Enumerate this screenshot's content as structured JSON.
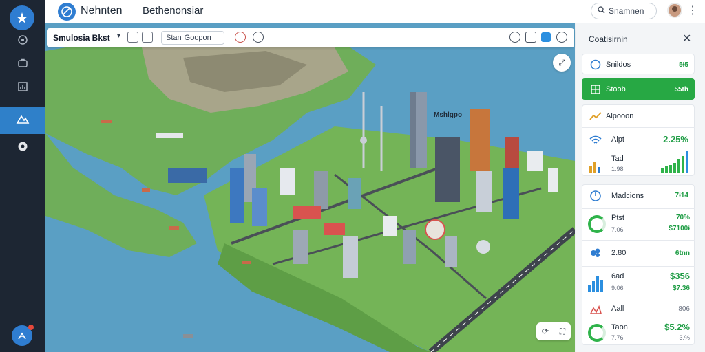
{
  "header": {
    "app_title": "Nehnten",
    "app_subtitle": "Bethenonsiar",
    "search_label": "Snamnen",
    "more_icon": "more-vertical-icon"
  },
  "sidebar": {
    "logo_icon": "app-logo-icon",
    "items": [
      {
        "icon": "compass-icon",
        "active": false
      },
      {
        "icon": "briefcase-icon",
        "active": false
      },
      {
        "icon": "chart-icon",
        "active": false
      },
      {
        "icon": "terrain-icon",
        "active": true
      },
      {
        "icon": "eye-icon",
        "active": false
      }
    ],
    "user_icon": "user-icon"
  },
  "toolbar": {
    "simulation_label": "Smulosia Bkst",
    "search_placeholder": "Stan",
    "search_value": "Goopon"
  },
  "map": {
    "label": "Mshlgpo"
  },
  "panel": {
    "title": "Coatisirnin",
    "items": {
      "stats": {
        "label": "Snildos",
        "value": "5Ɨ5"
      },
      "stock": {
        "label": "Stoob",
        "value": "55th"
      },
      "apps": {
        "label": "Alpooon"
      },
      "alert": {
        "label": "Alpt",
        "value": "2.25%",
        "sub1": "Tad",
        "sub2": "1.98"
      },
      "models": {
        "label": "Madcions",
        "value": "7ɨ14"
      },
      "r1": {
        "label": "Ptst",
        "value": "70%",
        "sub1": "7.06",
        "sub2": "$7100ɨ"
      },
      "r2": {
        "label": "2.80",
        "value": "6tnn"
      },
      "r3": {
        "label": "6ad",
        "value": "$356",
        "sub1": "9.06",
        "sub2": "$7.36"
      },
      "r4": {
        "label": "Aall",
        "value": "806"
      },
      "r5": {
        "label": "Taon",
        "value": "$5.2%",
        "sub1": "7.76",
        "sub2": "3.%"
      }
    }
  },
  "colors": {
    "sidebar_bg": "#1d2633",
    "accent": "#2f7dd1",
    "active_item": "#2f80c9",
    "success": "#27a844",
    "water": "#5a9fc4",
    "land": "#6fae5a"
  }
}
